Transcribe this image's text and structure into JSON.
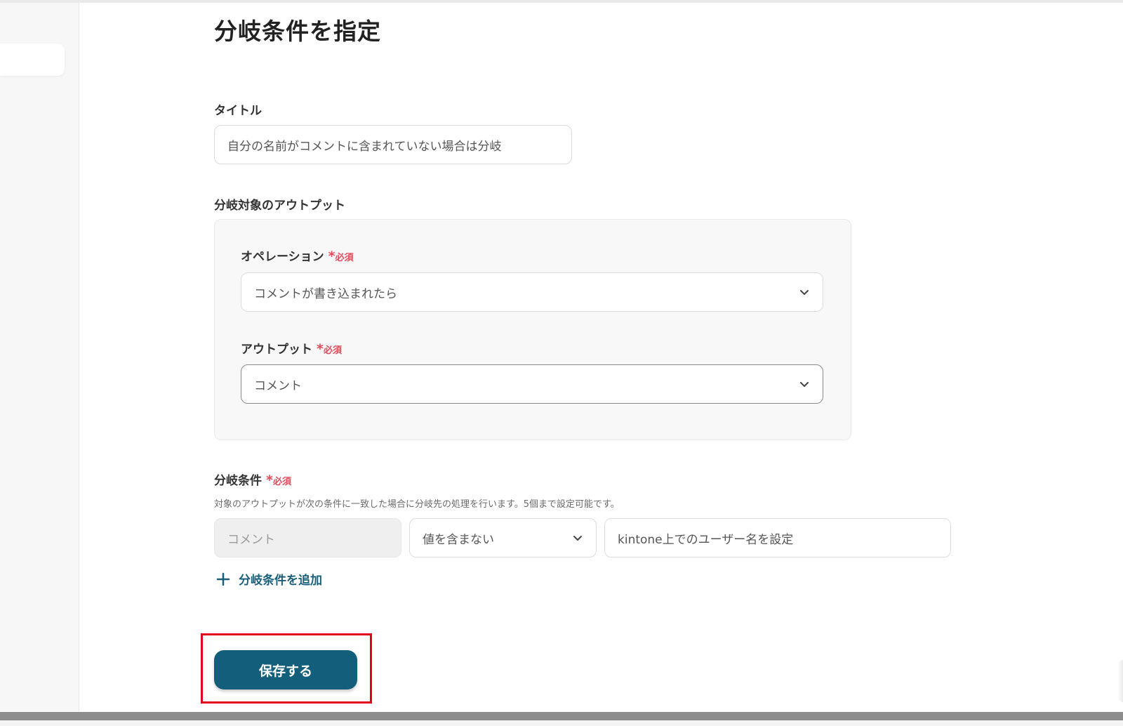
{
  "page": {
    "title": "分岐条件を指定"
  },
  "title_field": {
    "label": "タイトル",
    "value": "自分の名前がコメントに含まれていない場合は分岐"
  },
  "output_section": {
    "label": "分岐対象のアウトプット",
    "operation": {
      "label": "オペレーション",
      "required_mark": "*",
      "required_text": "必須",
      "selected": "コメントが書き込まれたら",
      "icon": "chevron-down-icon"
    },
    "output": {
      "label": "アウトプット",
      "required_mark": "*",
      "required_text": "必須",
      "selected": "コメント",
      "icon": "chevron-down-icon"
    }
  },
  "condition_section": {
    "label": "分岐条件",
    "required_mark": "*",
    "required_text": "必須",
    "hint": "対象のアウトプットが次の条件に一致した場合に分岐先の処理を行います。5個まで設定可能です。",
    "condition_field": "コメント",
    "operator": "値を含まない",
    "value": "kintone上でのユーザー名を設定",
    "add_label": "分岐条件を追加",
    "add_icon": "plus-icon"
  },
  "actions": {
    "save_label": "保存する"
  },
  "colors": {
    "accent": "#135f7b",
    "link": "#1a5f7a",
    "required": "#e04a5a",
    "highlight": "#e3001b"
  }
}
